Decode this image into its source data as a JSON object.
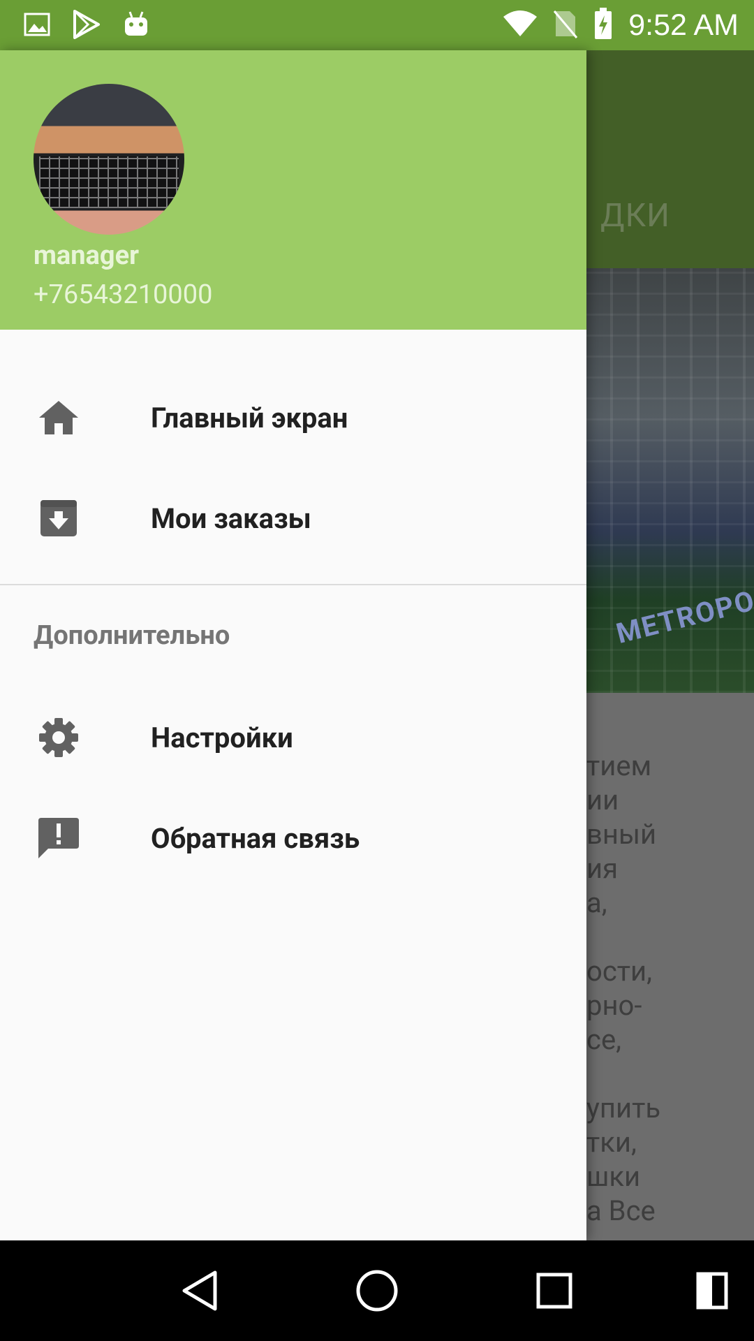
{
  "status_bar": {
    "time": "9:52 AM",
    "left_icons": [
      "image-icon",
      "play-store-icon",
      "android-icon"
    ],
    "right_icons": [
      "wifi-icon",
      "no-sim-icon",
      "battery-charging-icon"
    ],
    "color": "#6a9e35"
  },
  "background": {
    "toolbar_title_fragment": "ДКИ",
    "photo_ad_fragment": "METROPOLS",
    "body_text_fragments": "тием\nии\nвный\nия\nа,\n\nости,\nрно-\nсе,\n\nупить\nтки,\nшки\nа Все"
  },
  "drawer": {
    "header_color": "#9ccc65",
    "user": {
      "name": "manager",
      "phone": "+76543210000"
    },
    "items": [
      {
        "label": "Главный экран",
        "icon": "home-icon"
      },
      {
        "label": "Мои заказы",
        "icon": "archive-download-icon"
      }
    ],
    "section": {
      "title": "Дополнительно",
      "items": [
        {
          "label": "Настройки",
          "icon": "gear-icon"
        },
        {
          "label": "Обратная связь",
          "icon": "feedback-icon"
        }
      ]
    }
  },
  "nav_bar": {
    "buttons": [
      "back-icon",
      "home-circle-icon",
      "recents-icon",
      "split-screen-icon"
    ]
  }
}
